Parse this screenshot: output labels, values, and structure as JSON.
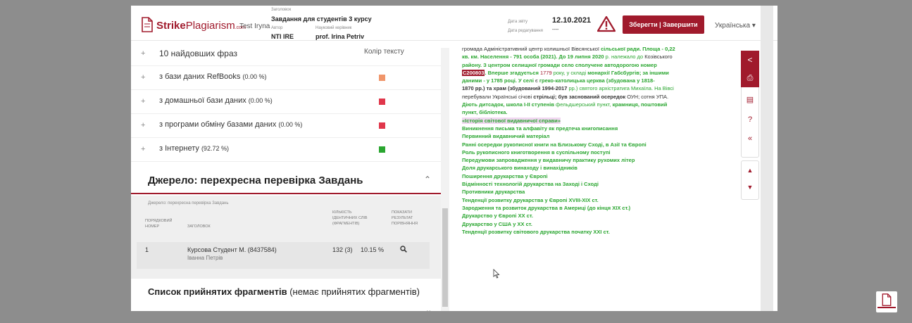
{
  "header": {
    "logo_bold": "Strike",
    "logo_plain": "Plagiarism",
    "logo_com": ".com",
    "user": "Test Iryna",
    "title_label": "Заголовок",
    "title_value": "Завдання для студентів 3 курсу",
    "author_label": "Автор",
    "author_value": "NTI IRE",
    "supervisor_label": "Науковий керівник",
    "supervisor_value": "prof. Irina Petriv",
    "date_label": "Дата звіту",
    "date_value": "12.10.2021",
    "edit_label": "Дата редагування",
    "edit_value": "----",
    "save_button": "Зберегти | Завершити",
    "language": "Українська ▾"
  },
  "colors": {
    "accent": "#a01a2c",
    "green": "#2aa630",
    "orange": "#f0956a"
  },
  "left": {
    "color_header": "Колір тексту",
    "rows": [
      {
        "label": "10 найдовших фраз",
        "pct": ""
      },
      {
        "label": "з бази даних RefBooks",
        "pct": "(0.00 %)"
      },
      {
        "label": "з домашньої бази даних",
        "pct": "(0.00 %)"
      },
      {
        "label": "з програми обміну базами даних",
        "pct": "(0.00 %)"
      },
      {
        "label": "з Інтернету",
        "pct": "(92.72 %)"
      }
    ],
    "source_title": "Джерело: перехресна перевірка Завдань",
    "source_sub": "Джерело: перехресна перевірка Завдань",
    "col_num": "ПОРЯДКОВИЙ НОМЕР",
    "col_title": "ЗАГОЛОВОК",
    "col_count": "КІЛЬКІСТЬ ІДЕНТИЧНИХ СЛІВ (ФРАГМЕНТІВ)",
    "col_show": "ПОКАЗАТИ РЕЗУЛЬТАТ ПОРІВНЯННЯ",
    "row_num": "1",
    "row_title": "Курсова Студент М. (8437584)",
    "row_author": "Іванна Петрів",
    "row_count": "132 (3)",
    "row_pct": "10.15 %",
    "accept_bold": "Список прийнятих фрагментів",
    "accept_rest": " (немає прийнятих фрагментів)"
  },
  "doc": {
    "l1a": "громада ",
    "l1b": "Адміністративний центр ",
    "l1c": "колишньої ",
    "l1d": "Вівсянської",
    "l1e": " сільської ради. Площа ",
    "l1f": "- 0,22",
    "l2a": "кв. км. Населення ",
    "l2b": "- 791 особа (2021). До 19 липня 2020",
    "l2c": " р.  належало  до ",
    "l2d": "Козівського",
    "l3a": "району. З центром селищної громади село сполучене автодорогою номер",
    "l4a": "С200803",
    "l4b": ". Вперше  згадується ",
    "l4c": "1779 ",
    "l4d": "року,  у  складі ",
    "l4e": "монархії  Габсбургів; за іншими",
    "l5a": "даними ",
    "l5b": "- у 1785 році. У селі  ",
    "l5c": "є ",
    "l5d": "греко-католицька ",
    "l5e": "церква ",
    "l5f": "(збудована у 1818-",
    "l6a": "1870 ",
    "l6b": "рр.) та храм (збудований 1994-2017 ",
    "l6c": "рр.)  святого ",
    "l6d": "архістратига  Михаїла. На  Вівсі",
    "l7a": "перебували ",
    "l7b": "Українські  січові",
    "l7c": "  стрільці; був заснований  осередок ",
    "l7d": "ОУН; сотня ",
    "l7e": "УПА.",
    "l8a": "Діють дитсадок, школа  І-ІІ  ступенів ",
    "l8b": "фельдшерський  пункт, ",
    "l8c": " крамниця, поштовий",
    "l9a": "пункт, бібліотека.",
    "heading": "«Історія світової видавничої справи»",
    "topics": [
      "Виникнення письма та алфавіту як предтеча книгописання",
      "Первинний видавничий матеріал",
      "Ранні осередки рукописної книги на Близькому Сході, в Азії та Європі",
      "Роль рукописного книготворення в суспільному поступі",
      "Передумови запровадження у видавничу практику рухомих літер",
      "Доля друкарського винаходу і винахідників",
      "Поширення друкарства у Європі",
      "Відмінності технологій друкарства на Заході і Сході",
      "Противники друкарства",
      "Тенденції розвитку друкарства у Європі XVIII-XIX ст.",
      "Зародження та розвиток друкарства в Америці (до кінця XIX ст.)",
      "Друкарство у Європі XX ст.",
      "Друкарство у США у XX ст.",
      "Тенденції розвитку світового друкарства початку XXI ст."
    ]
  }
}
